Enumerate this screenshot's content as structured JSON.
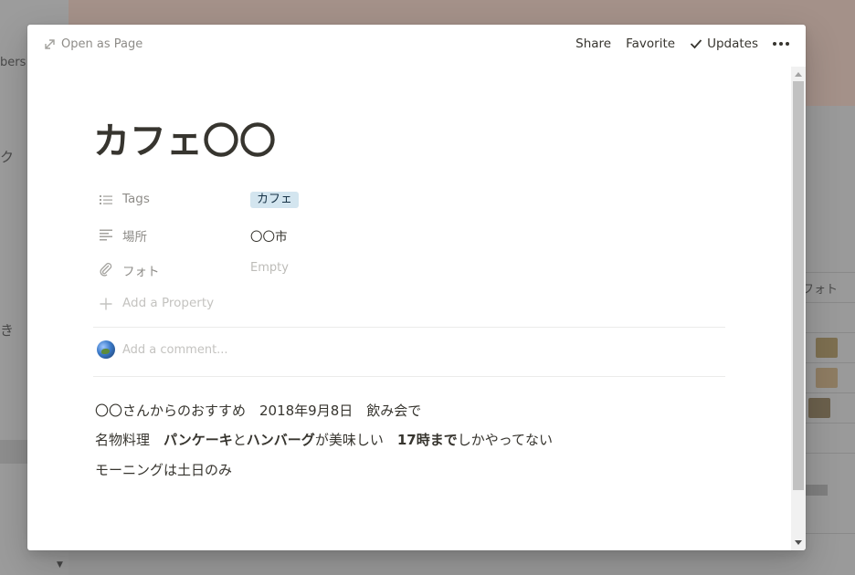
{
  "background": {
    "sidebar_fragments": [
      "bers",
      "ク",
      "き"
    ],
    "column_header": "フォト"
  },
  "topbar": {
    "open_as_page": "Open as Page",
    "share": "Share",
    "favorite": "Favorite",
    "updates": "Updates",
    "more_icon": "more-dots-icon"
  },
  "page": {
    "title": "カフェ〇〇",
    "properties": [
      {
        "icon": "list-icon",
        "label": "Tags",
        "value": "カフェ",
        "type": "multi_select"
      },
      {
        "icon": "text-icon",
        "label": "場所",
        "value": "〇〇市",
        "type": "text"
      },
      {
        "icon": "paperclip-icon",
        "label": "フォト",
        "value": "Empty",
        "type": "files"
      }
    ],
    "add_property": "Add a Property",
    "comment_placeholder": "Add a comment...",
    "body": {
      "line1": "〇〇さんからのおすすめ　2018年9月8日　飲み会で",
      "line2": {
        "p1": "名物料理　",
        "b1": "パンケーキ",
        "p2": "と",
        "b2": "ハンバーグ",
        "p3": "が美味しい　",
        "b3": "17時まで",
        "p4": "しかやってない"
      },
      "line3": "モーニングは土日のみ"
    }
  },
  "colors": {
    "tag_bg": "#d3e5ef",
    "text": "#37352f",
    "muted": "#8e8c88",
    "placeholder": "#c4c3c0"
  }
}
